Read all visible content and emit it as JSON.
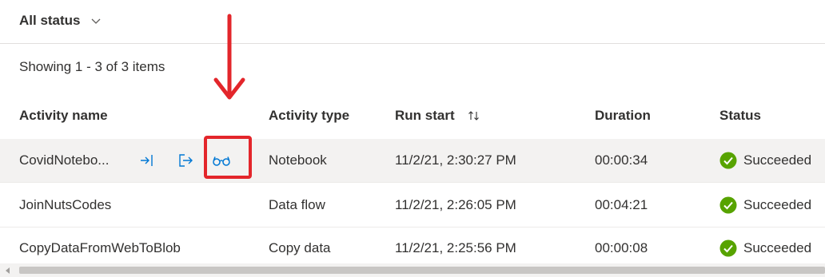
{
  "filter": {
    "label": "All status",
    "chevron_icon": "chevron-down-icon"
  },
  "summary": "Showing 1 - 3 of 3 items",
  "columns": {
    "name": "Activity name",
    "type": "Activity type",
    "run_start": "Run start",
    "duration": "Duration",
    "status": "Status"
  },
  "rows": [
    {
      "name": "CovidNotebo...",
      "type": "Notebook",
      "run_start": "11/2/21, 2:30:27 PM",
      "duration": "00:00:34",
      "status": "Succeeded"
    },
    {
      "name": "JoinNutsCodes",
      "type": "Data flow",
      "run_start": "11/2/21, 2:26:05 PM",
      "duration": "00:04:21",
      "status": "Succeeded"
    },
    {
      "name": "CopyDataFromWebToBlob",
      "type": "Copy data",
      "run_start": "11/2/21, 2:25:56 PM",
      "duration": "00:00:08",
      "status": "Succeeded"
    }
  ],
  "icons": {
    "input": "input-icon",
    "output": "output-icon",
    "details": "glasses-icon",
    "sort": "sort-icon",
    "success": "checkmark-circle-icon"
  },
  "colors": {
    "accent": "#0078d4",
    "success": "#57a300",
    "annotation": "#e3262b",
    "row_hover": "#f3f2f1"
  }
}
